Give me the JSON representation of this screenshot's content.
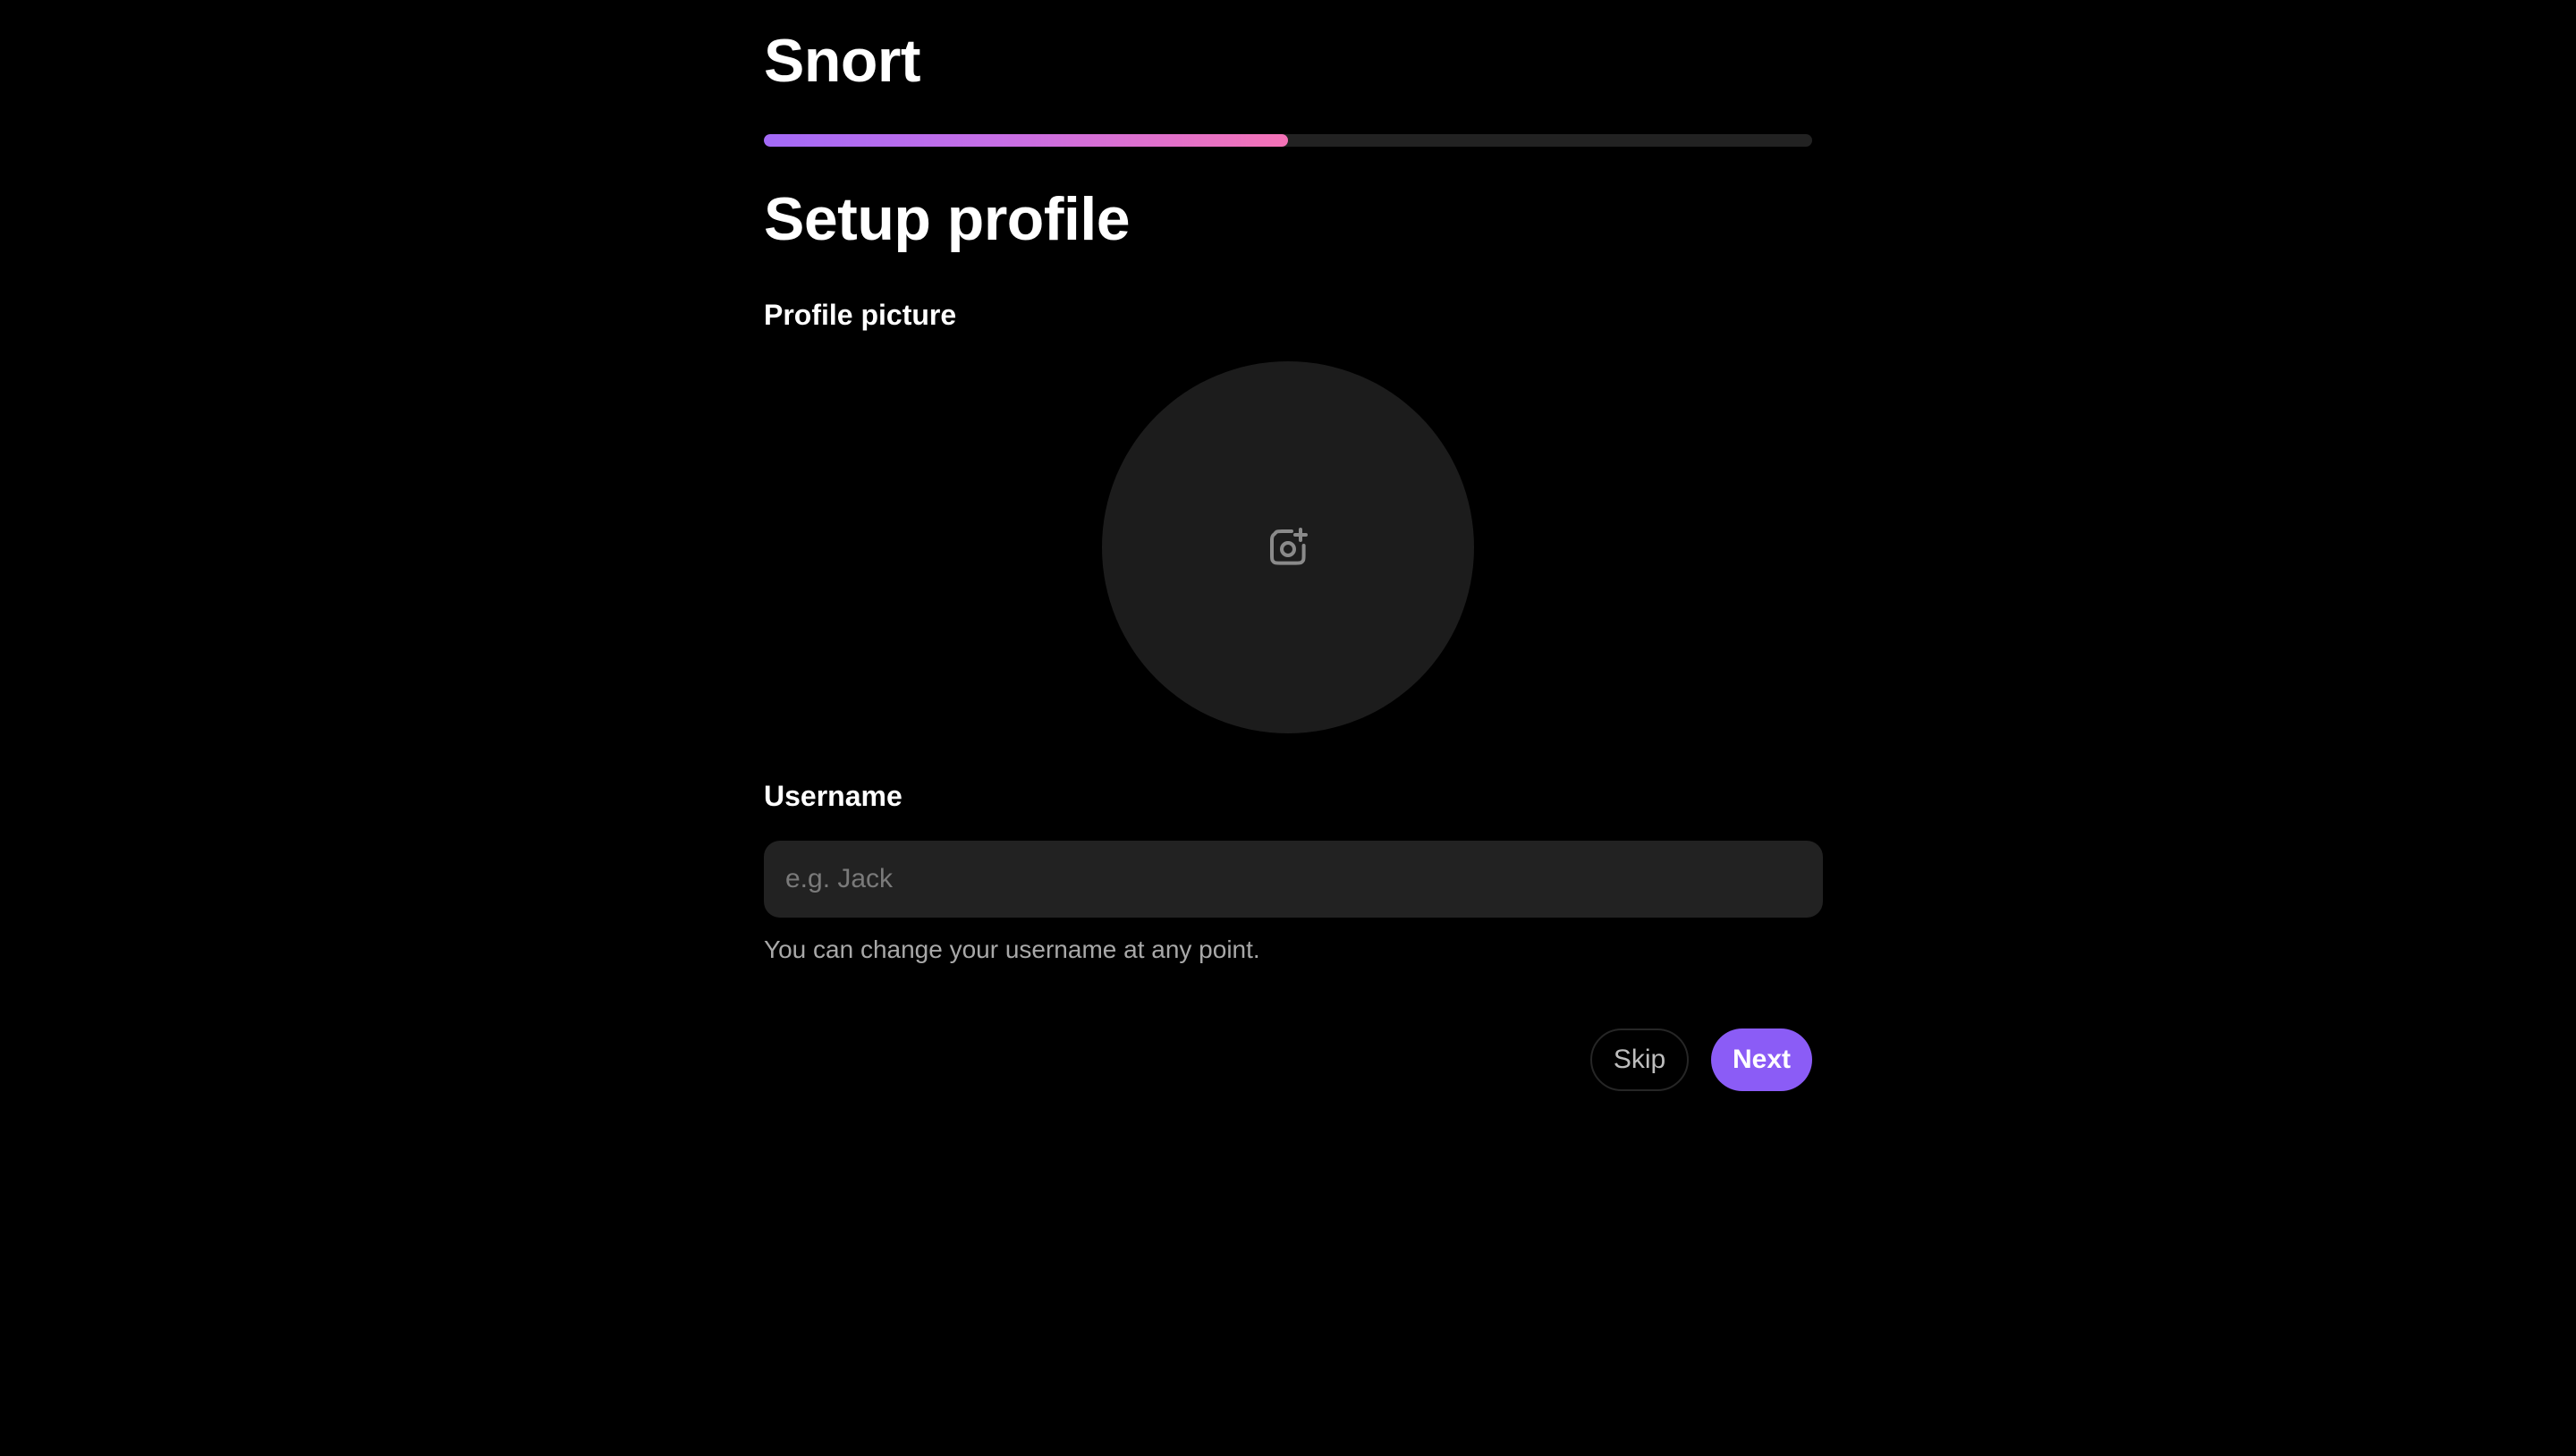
{
  "app": {
    "brand": "Snort"
  },
  "progress": {
    "fraction": 0.5
  },
  "page": {
    "title": "Setup profile"
  },
  "profile_picture": {
    "label": "Profile picture",
    "icon": "camera-add-icon"
  },
  "username": {
    "label": "Username",
    "value": "",
    "placeholder": "e.g. Jack",
    "helper": "You can change your username at any point."
  },
  "actions": {
    "skip_label": "Skip",
    "next_label": "Next"
  },
  "colors": {
    "background": "#000000",
    "accent": "#8b5cf6",
    "gradient_start": "#a36af7",
    "gradient_end": "#f472b6",
    "surface": "#222222"
  }
}
